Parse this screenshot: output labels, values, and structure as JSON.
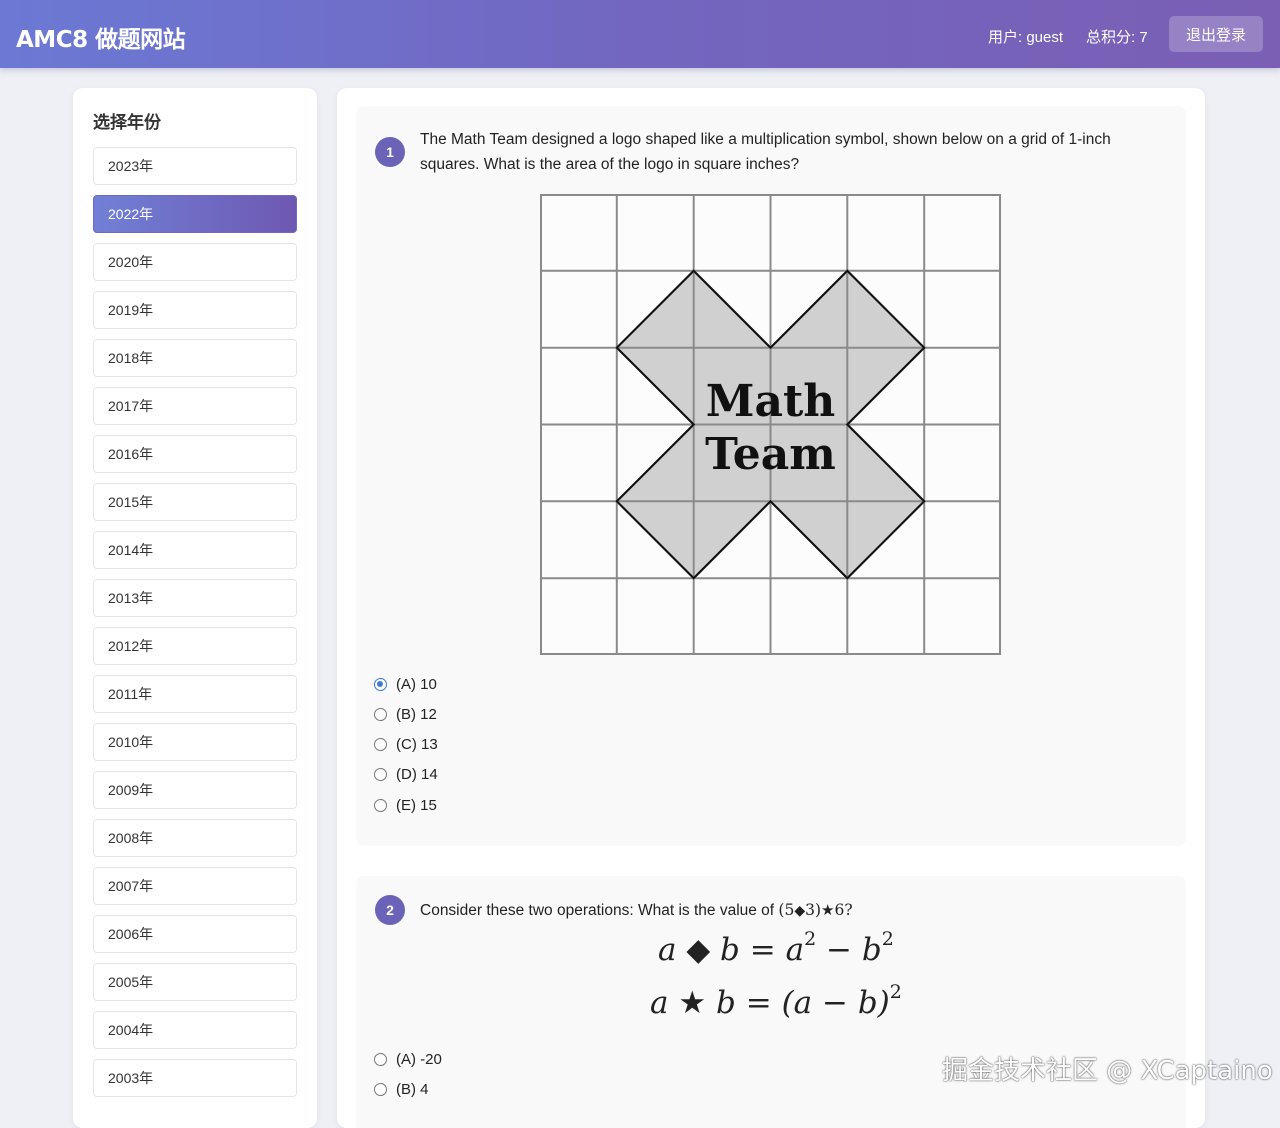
{
  "header": {
    "brand": "AMC8 做题网站",
    "user": "用户: guest",
    "score": "总积分: 7",
    "logout": "退出登录"
  },
  "sidebar": {
    "title": "选择年份",
    "active_index": 1,
    "years": [
      "2023年",
      "2022年",
      "2020年",
      "2019年",
      "2018年",
      "2017年",
      "2016年",
      "2015年",
      "2014年",
      "2013年",
      "2012年",
      "2011年",
      "2010年",
      "2009年",
      "2008年",
      "2007年",
      "2006年",
      "2005年",
      "2004年",
      "2003年"
    ]
  },
  "questions": [
    {
      "number": "1",
      "text": "The Math Team designed a logo shaped like a multiplication symbol, shown below on a grid of 1-inch squares. What is the area of the logo in square inches?",
      "figure_text": [
        "Math",
        "Team"
      ],
      "options": [
        "(A) 10",
        "(B) 12",
        "(C) 13",
        "(D) 14",
        "(E) 15"
      ],
      "selected": 0
    },
    {
      "number": "2",
      "text_prefix": "Consider these two operations: What is the value of ",
      "expr_open": "(5",
      "expr_mid": "3)",
      "expr_end": "6?",
      "formula1": {
        "a": "a",
        "b": "b",
        "eq": "=",
        "rhs1": "a",
        "rhs1_exp": "2",
        "minus": "−",
        "rhs2": "b",
        "rhs2_exp": "2"
      },
      "formula2": {
        "a": "a",
        "b": "b",
        "eq": "=",
        "rhs": "(a − b)",
        "rhs_exp": "2"
      },
      "options": [
        "(A) -20",
        "(B) 4"
      ]
    }
  ],
  "watermark": "掘金技术社区 @ XCaptaino"
}
